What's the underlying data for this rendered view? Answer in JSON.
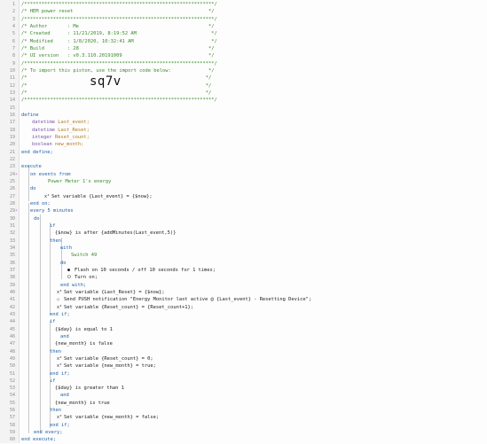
{
  "lines": [
    {
      "n": "1",
      "t": "/******************************************************************/"
    },
    {
      "n": "2",
      "t": "/* HEM power reset                                               */"
    },
    {
      "n": "3",
      "t": "/******************************************************************/"
    },
    {
      "n": "4",
      "t": "/* Author       : Me                                             */"
    },
    {
      "n": "5",
      "t": "/* Created      : 11/21/2019, 8:19:52 AM                          */"
    },
    {
      "n": "6",
      "t": "/* Modified     : 1/8/2020, 10:32:41 AM                           */"
    },
    {
      "n": "7",
      "t": "/* Build        : 28                                             */"
    },
    {
      "n": "8",
      "t": "/* UI version   : v0.3.110.20191009                              */"
    },
    {
      "n": "9",
      "t": "/******************************************************************/"
    },
    {
      "n": "10",
      "t": "/* To import this piston, use the import code below:             */"
    },
    {
      "n": "11",
      "t": "/*                                                              */"
    },
    {
      "n": "12",
      "t": "/*                                                              */"
    },
    {
      "n": "13",
      "t": "/*                                                              */"
    },
    {
      "n": "14",
      "t": "/******************************************************************/"
    },
    {
      "n": "15",
      "t": ""
    },
    {
      "n": "16",
      "t": "define"
    },
    {
      "n": "17",
      "t": "datetime Last_event;"
    },
    {
      "n": "18",
      "t": "datetime Last_Reset;"
    },
    {
      "n": "19",
      "t": "integer Reset_count;"
    },
    {
      "n": "20",
      "t": "boolean new_month;"
    },
    {
      "n": "21",
      "t": "end define;"
    },
    {
      "n": "22",
      "t": ""
    },
    {
      "n": "23",
      "t": "execute"
    },
    {
      "n": "24",
      "t": "on events from"
    },
    {
      "n": "25",
      "t": "Power Meter 1's energy"
    },
    {
      "n": "26",
      "t": "do"
    },
    {
      "n": "27",
      "t": "Set variable {Last_event} = {$now};"
    },
    {
      "n": "28",
      "t": "end on;"
    },
    {
      "n": "29",
      "t": "every 5 minutes"
    },
    {
      "n": "30",
      "t": "do"
    },
    {
      "n": "31",
      "t": "if"
    },
    {
      "n": "32",
      "t": "{$now} is after {addMinutes(Last_event,5)}"
    },
    {
      "n": "33",
      "t": "then"
    },
    {
      "n": "34",
      "t": "with"
    },
    {
      "n": "35",
      "t": "Switch 49"
    },
    {
      "n": "36",
      "t": "do"
    },
    {
      "n": "37",
      "t": "Flash on 10 seconds / off 10 seconds for 1 times;"
    },
    {
      "n": "38",
      "t": "Turn on;"
    },
    {
      "n": "39",
      "t": "end with;"
    },
    {
      "n": "40",
      "t": "Set variable {Last_Reset} = {$now};"
    },
    {
      "n": "41",
      "t": "Send PUSH notification \"Energy Monitor last active @ {Last_event} - Resetting Device\";"
    },
    {
      "n": "42",
      "t": "Set variable {Reset_count} = {Reset_count+1};"
    },
    {
      "n": "43",
      "t": "end if;"
    },
    {
      "n": "44",
      "t": "if"
    },
    {
      "n": "45",
      "t": "{$day} is equal to 1"
    },
    {
      "n": "46",
      "t": "and"
    },
    {
      "n": "47",
      "t": "{new_month} is false"
    },
    {
      "n": "48",
      "t": "then"
    },
    {
      "n": "49",
      "t": "Set variable {Reset_count} = 0;"
    },
    {
      "n": "50",
      "t": "Set variable {new_month} = true;"
    },
    {
      "n": "51",
      "t": "end if;"
    },
    {
      "n": "52",
      "t": "if"
    },
    {
      "n": "53",
      "t": "{$day} is greater than 1"
    },
    {
      "n": "54",
      "t": "and"
    },
    {
      "n": "55",
      "t": "{new_month} is true"
    },
    {
      "n": "56",
      "t": "then"
    },
    {
      "n": "57",
      "t": "Set variable {new_month} = false;"
    },
    {
      "n": "58",
      "t": "end if;"
    },
    {
      "n": "59",
      "t": "end every;"
    },
    {
      "n": "60",
      "t": "end execute;"
    }
  ],
  "import_code": "sq7v",
  "markers": {
    "24": "⚡",
    "29": "⚡"
  },
  "icons": {
    "set_variable": "x-squared-icon",
    "flash": "flash-icon",
    "turn_on": "power-icon",
    "push": "message-icon"
  }
}
